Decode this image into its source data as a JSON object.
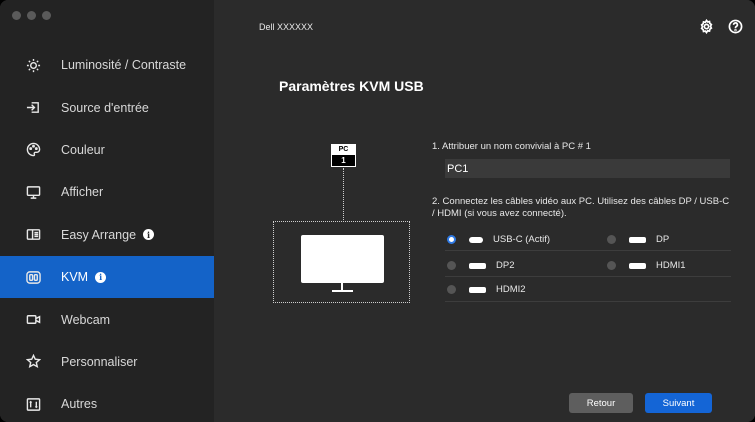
{
  "window": {
    "title": "Dell XXXXXX",
    "traffic_colors": [
      "#5a5a5a",
      "#5a5a5a",
      "#5a5a5a"
    ]
  },
  "sidebar": {
    "items": [
      {
        "label": "Luminosité / Contraste",
        "icon": "brightness-icon",
        "active": false
      },
      {
        "label": "Source d'entrée",
        "icon": "input-source-icon",
        "active": false
      },
      {
        "label": "Couleur",
        "icon": "color-palette-icon",
        "active": false
      },
      {
        "label": "Afficher",
        "icon": "display-icon",
        "active": false
      },
      {
        "label": "Easy Arrange",
        "icon": "easy-arrange-icon",
        "active": false,
        "info": "i"
      },
      {
        "label": "KVM",
        "icon": "kvm-icon",
        "active": true,
        "info": "i"
      },
      {
        "label": "Webcam",
        "icon": "webcam-icon",
        "active": false
      },
      {
        "label": "Personnaliser",
        "icon": "star-icon",
        "active": false
      },
      {
        "label": "Autres",
        "icon": "others-icon",
        "active": false
      }
    ]
  },
  "main": {
    "title": "Paramètres KVM USB",
    "diagram": {
      "badge_label": "PC",
      "badge_number": "1"
    },
    "step1": {
      "label": "1. Attribuer un nom convivial à PC # 1",
      "input_value": "PC1"
    },
    "step2": {
      "label": "2. Connectez les câbles vidéo aux PC. Utilisez des câbles DP / USB-C / HDMI (si vous avez connecté).",
      "options": [
        {
          "label": "USB-C (Actif)",
          "selected": true
        },
        {
          "label": "DP",
          "selected": false
        },
        {
          "label": "DP2",
          "selected": false
        },
        {
          "label": "HDMI1",
          "selected": false
        },
        {
          "label": "HDMI2",
          "selected": false
        }
      ]
    },
    "buttons": {
      "back": "Retour",
      "next": "Suivant"
    }
  },
  "colors": {
    "accent": "#1463c8",
    "sidebar_bg": "#232323",
    "main_bg": "#2b2b2b"
  }
}
